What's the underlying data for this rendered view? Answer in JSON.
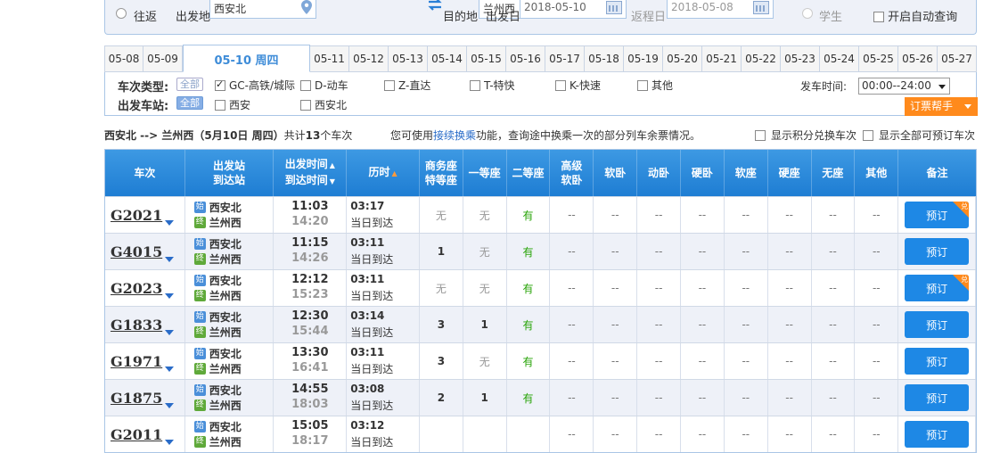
{
  "search": {
    "trip_return_label": "往返",
    "from_label": "出发地",
    "from_value": "西安北",
    "to_label": "目的地",
    "to_value": "兰州西",
    "depart_label": "出发日",
    "depart_value": "2018-05-10",
    "return_label": "返程日",
    "return_value": "2018-05-08",
    "student_label": "学生",
    "auto_query_label": "开启自动查询"
  },
  "dates": [
    "05-08",
    "05-09",
    "05-10 周四",
    "05-11",
    "05-12",
    "05-13",
    "05-14",
    "05-15",
    "05-16",
    "05-17",
    "05-18",
    "05-19",
    "05-20",
    "05-21",
    "05-22",
    "05-23",
    "05-24",
    "05-25",
    "05-26",
    "05-27"
  ],
  "active_date_index": 2,
  "filters": {
    "type_label": "车次类型:",
    "station_label": "出发车站:",
    "all": "全部",
    "types": [
      "GC-高铁/城际",
      "D-动车",
      "Z-直达",
      "T-特快",
      "K-快速",
      "其他"
    ],
    "stations": [
      "西安",
      "西安北"
    ],
    "time_label": "发车时间:",
    "time_value": "00:00--24:00",
    "help_label": "订票帮手"
  },
  "summary": {
    "route": "西安北 --> 兰州西（5月10日  周四）",
    "count_prefix": "共计",
    "count": "13",
    "count_suffix": "个车次",
    "hint_pre": "您可使用",
    "hint_link": "接续换乘",
    "hint_post": "功能，查询途中换乘一次的部分列车余票情况。",
    "opt1": "显示积分兑换车次",
    "opt2": "显示全部可预订车次"
  },
  "table": {
    "headers": {
      "train": "车次",
      "stations_a": "出发站",
      "stations_b": "到达站",
      "time_a": "出发时间",
      "time_b": "到达时间",
      "duration": "历时",
      "business_a": "商务座",
      "business_b": "特等座",
      "first": "一等座",
      "second": "二等座",
      "deluxe_a": "高级",
      "deluxe_b": "软卧",
      "soft_sleeper": "软卧",
      "motion_sleeper": "动卧",
      "hard_sleeper": "硬卧",
      "soft_seat": "软座",
      "hard_seat": "硬座",
      "no_seat": "无座",
      "other": "其他",
      "remark": "备注"
    },
    "start_icon": "始",
    "end_icon": "终",
    "book_label": "预订",
    "flag_label": "兑",
    "rows": [
      {
        "no": "G2021",
        "from": "西安北",
        "to": "兰州西",
        "dep": "11:03",
        "arr": "14:20",
        "dur": "03:17",
        "day": "当日到达",
        "biz": "无",
        "first": "无",
        "second": "有",
        "flag": true
      },
      {
        "no": "G4015",
        "from": "西安北",
        "to": "兰州西",
        "dep": "11:15",
        "arr": "14:26",
        "dur": "03:11",
        "day": "当日到达",
        "biz": "1",
        "first": "无",
        "second": "有",
        "flag": false
      },
      {
        "no": "G2023",
        "from": "西安北",
        "to": "兰州西",
        "dep": "12:12",
        "arr": "15:23",
        "dur": "03:11",
        "day": "当日到达",
        "biz": "无",
        "first": "无",
        "second": "有",
        "flag": true
      },
      {
        "no": "G1833",
        "from": "西安北",
        "to": "兰州西",
        "dep": "12:30",
        "arr": "15:44",
        "dur": "03:14",
        "day": "当日到达",
        "biz": "3",
        "first": "1",
        "second": "有",
        "flag": false
      },
      {
        "no": "G1971",
        "from": "西安北",
        "to": "兰州西",
        "dep": "13:30",
        "arr": "16:41",
        "dur": "03:11",
        "day": "当日到达",
        "biz": "3",
        "first": "无",
        "second": "有",
        "flag": false
      },
      {
        "no": "G1875",
        "from": "西安北",
        "to": "兰州西",
        "dep": "14:55",
        "arr": "18:03",
        "dur": "03:08",
        "day": "当日到达",
        "biz": "2",
        "first": "1",
        "second": "有",
        "flag": false
      },
      {
        "no": "G2011",
        "from": "西安北",
        "to": "兰州西",
        "dep": "15:05",
        "arr": "18:17",
        "dur": "03:12",
        "day": "当日到达",
        "biz": "",
        "first": "",
        "second": "",
        "flag": false
      }
    ],
    "dash": "--"
  }
}
